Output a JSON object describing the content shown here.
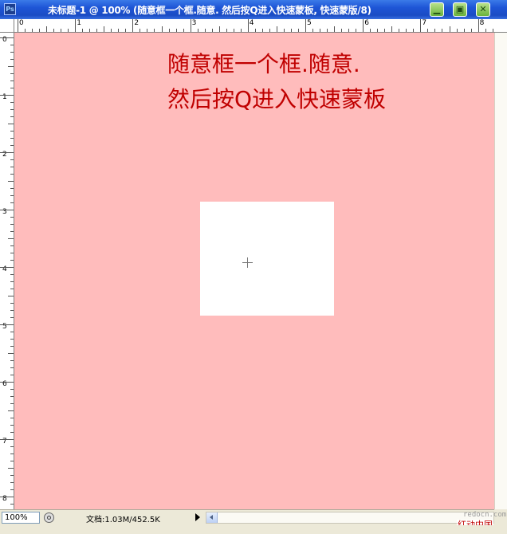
{
  "window": {
    "title": "未标题-1 @ 100% (随意框一个框.随意. 然后按Q进入快速蒙板, 快速蒙版/8)",
    "app_icon_label": "Ps",
    "canvas_color": "#ffbcbc",
    "controls": {
      "minimize_icon": "minimize-icon",
      "maximize_icon": "maximize-icon",
      "close_icon": "close-icon"
    }
  },
  "rulers": {
    "top_labels": [
      "0",
      "1",
      "2",
      "3",
      "4",
      "5",
      "6",
      "7",
      "8"
    ],
    "left_labels": [
      "0",
      "1",
      "2",
      "3",
      "4",
      "5",
      "6",
      "7",
      "8"
    ]
  },
  "canvas": {
    "caption_line1": "随意框一个框.随意.",
    "caption_line2": "然后按Q进入快速蒙板",
    "caption_color": "#c00000",
    "selection_color": "#ffffff"
  },
  "statusbar": {
    "zoom": "100%",
    "doc_info": "文档:1.03M/452.5K"
  },
  "watermark": {
    "domain": "redocn.com",
    "brand": "红动中国"
  }
}
